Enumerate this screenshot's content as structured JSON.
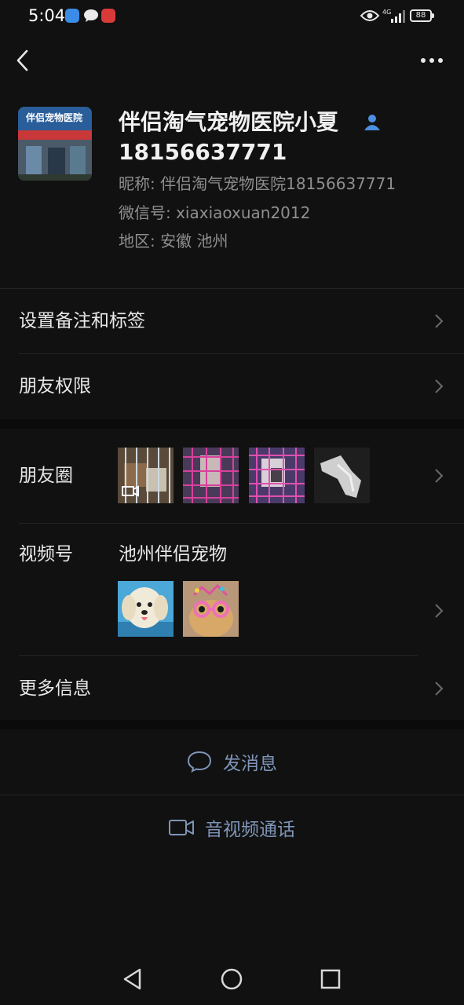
{
  "status_bar": {
    "time": "5:04",
    "battery": "88",
    "network": "4G"
  },
  "nav": {
    "back_icon": "chevron-left-icon",
    "more_icon": "more-dots-icon"
  },
  "profile": {
    "name_line1": "伴侣淘气宠物医院小夏",
    "name_line2": "18156637771",
    "nickname": "昵称: 伴侣淘气宠物医院18156637771",
    "wechat_id": "微信号: xiaxiaoxuan2012",
    "region": "地区: 安徽  池州",
    "avatar_sign_text": "伴侣宠物医院"
  },
  "menu": {
    "set_remark": "设置备注和标签",
    "friend_permissions": "朋友权限",
    "moments": "朋友圈",
    "channels": "视频号",
    "channels_name": "池州伴侣宠物",
    "more_info": "更多信息"
  },
  "actions": {
    "send_message": "发消息",
    "video_call": "音视频通话"
  },
  "colors": {
    "background": "#111111",
    "action_text": "#7e95b8",
    "contact_icon": "#4a8fe0"
  }
}
